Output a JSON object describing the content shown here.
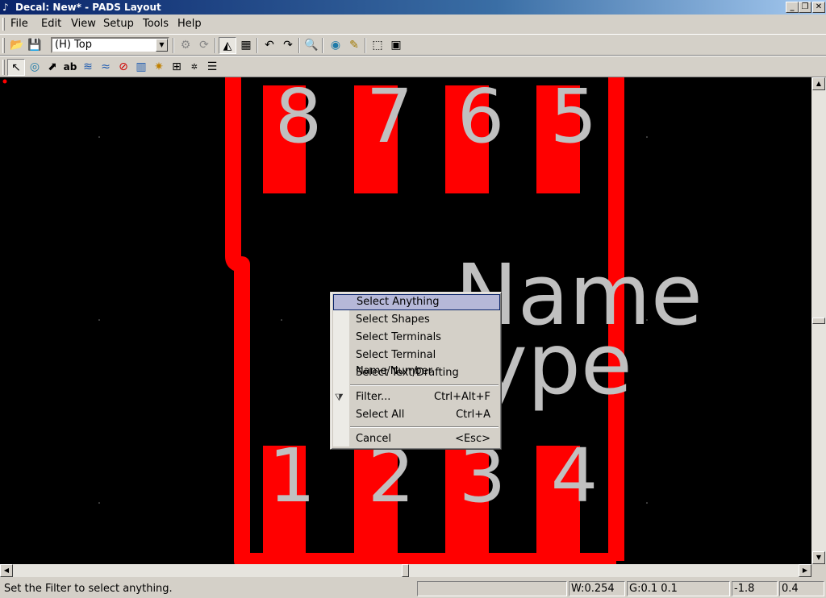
{
  "window": {
    "title": "Decal: New* - PADS Layout",
    "min_glyph": "_",
    "max_glyph": "❐",
    "close_glyph": "✕"
  },
  "menu": {
    "items": [
      "File",
      "Edit",
      "View",
      "Setup",
      "Tools",
      "Help"
    ]
  },
  "toolbar": {
    "layer_value": "(H) Top"
  },
  "canvas": {
    "pad_numbers_top": [
      "8",
      "7",
      "6",
      "5"
    ],
    "pad_numbers_bottom": [
      "1",
      "2",
      "3",
      "4"
    ],
    "label_name": "Name",
    "label_type": "Type",
    "colors": {
      "background": "#000000",
      "copper": "#ff0000",
      "text": "#c0c0c0"
    }
  },
  "context_menu": {
    "items": [
      {
        "label": "Select Anything",
        "accel": "",
        "highlighted": true
      },
      {
        "label": "Select Shapes",
        "accel": ""
      },
      {
        "label": "Select Terminals",
        "accel": ""
      },
      {
        "label": "Select Terminal Name/Number",
        "accel": ""
      },
      {
        "label": "Select Text/Drafting",
        "accel": ""
      },
      {
        "label": "Filter...",
        "accel": "Ctrl+Alt+F"
      },
      {
        "label": "Select All",
        "accel": "Ctrl+A"
      },
      {
        "label": "Cancel",
        "accel": "<Esc>"
      }
    ]
  },
  "status": {
    "message": "Set the Filter to select anything.",
    "width": "W:0.254",
    "grid": "G:0.1 0.1",
    "x": "-1.8",
    "y": "0.4"
  }
}
